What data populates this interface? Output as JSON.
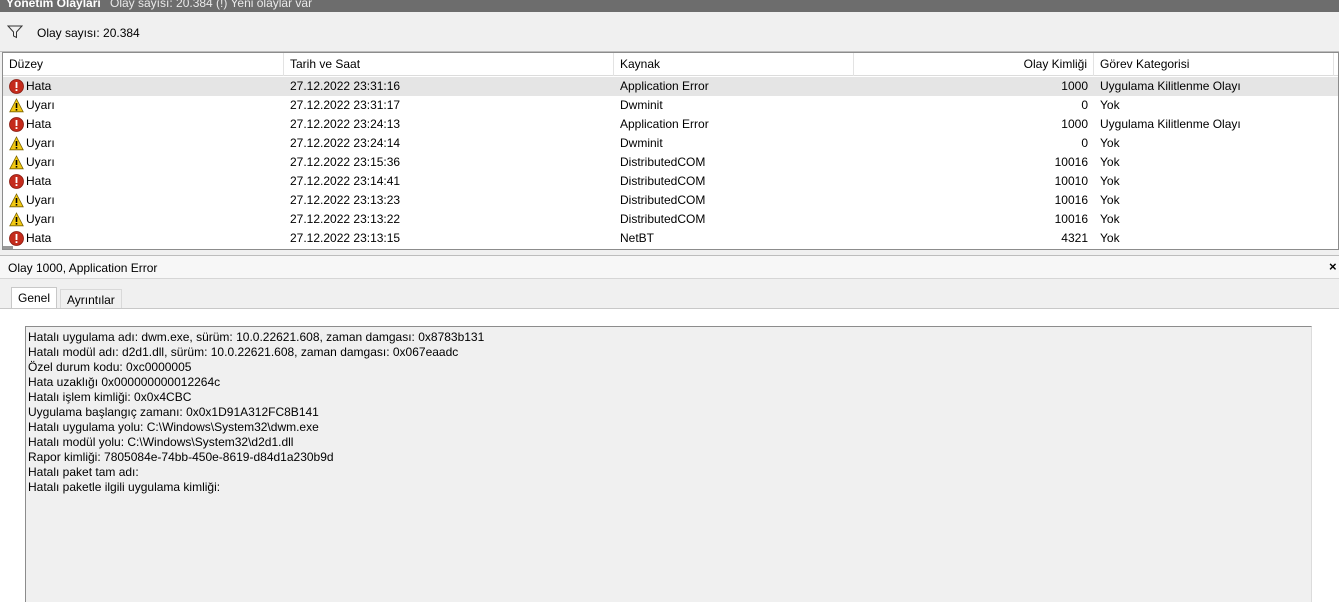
{
  "window": {
    "title": "Yönetim Olayları",
    "subtitle": "Olay sayısı: 20.384 (!) Yeni olaylar var"
  },
  "filter": {
    "count_label": "Olay sayısı: 20.384"
  },
  "grid": {
    "columns": [
      "Düzey",
      "Tarih ve Saat",
      "Kaynak",
      "Olay Kimliği",
      "Görev Kategorisi"
    ],
    "rows": [
      {
        "level": "Hata",
        "date": "27.12.2022 23:31:16",
        "source": "Application Error",
        "id": "1000",
        "category": "Uygulama Kilitlenme Olayı"
      },
      {
        "level": "Uyarı",
        "date": "27.12.2022 23:31:17",
        "source": "Dwminit",
        "id": "0",
        "category": "Yok"
      },
      {
        "level": "Hata",
        "date": "27.12.2022 23:24:13",
        "source": "Application Error",
        "id": "1000",
        "category": "Uygulama Kilitlenme Olayı"
      },
      {
        "level": "Uyarı",
        "date": "27.12.2022 23:24:14",
        "source": "Dwminit",
        "id": "0",
        "category": "Yok"
      },
      {
        "level": "Uyarı",
        "date": "27.12.2022 23:15:36",
        "source": "DistributedCOM",
        "id": "10016",
        "category": "Yok"
      },
      {
        "level": "Hata",
        "date": "27.12.2022 23:14:41",
        "source": "DistributedCOM",
        "id": "10010",
        "category": "Yok"
      },
      {
        "level": "Uyarı",
        "date": "27.12.2022 23:13:23",
        "source": "DistributedCOM",
        "id": "10016",
        "category": "Yok"
      },
      {
        "level": "Uyarı",
        "date": "27.12.2022 23:13:22",
        "source": "DistributedCOM",
        "id": "10016",
        "category": "Yok"
      },
      {
        "level": "Hata",
        "date": "27.12.2022 23:13:15",
        "source": "NetBT",
        "id": "4321",
        "category": "Yok"
      }
    ]
  },
  "detail": {
    "title": "Olay 1000, Application Error",
    "close_glyph": "×",
    "tabs": [
      "Genel",
      "Ayrıntılar"
    ],
    "lines": [
      "Hatalı uygulama adı: dwm.exe, sürüm: 10.0.22621.608, zaman damgası: 0x8783b131",
      "Hatalı modül adı: d2d1.dll, sürüm: 10.0.22621.608, zaman damgası: 0x067eaadc",
      "Özel durum kodu: 0xc0000005",
      "Hata uzaklığı 0x000000000012264c",
      "Hatalı işlem kimliği: 0x0x4CBC",
      "Uygulama başlangıç zamanı: 0x0x1D91A312FC8B141",
      "Hatalı uygulama yolu: C:\\Windows\\System32\\dwm.exe",
      "Hatalı modül yolu: C:\\Windows\\System32\\d2d1.dll",
      "Rapor kimliği: 7805084e-74bb-450e-8619-d84d1a230b9d",
      "Hatalı paket tam adı:",
      "Hatalı paketle ilgili uygulama kimliği:"
    ]
  },
  "icons": {
    "error": "error-icon",
    "warning": "warning-icon",
    "filter": "filter-icon"
  },
  "colors": {
    "error": "#c42b1c",
    "warning": "#f2c811",
    "titlebar": "#6d6d6d",
    "selected_row": "#e5e5e5"
  }
}
